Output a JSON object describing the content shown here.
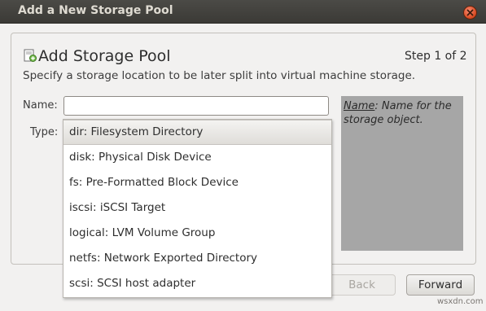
{
  "window": {
    "title": "Add a New Storage Pool"
  },
  "header": {
    "title": "Add Storage Pool",
    "step": "Step 1 of 2",
    "subtitle": "Specify a storage location to be later split into virtual machine storage."
  },
  "form": {
    "name_label": "Name:",
    "name_value": "",
    "type_label": "Type:",
    "type_options": [
      "dir: Filesystem Directory",
      "disk: Physical Disk Device",
      "fs: Pre-Formatted Block Device",
      "iscsi: iSCSI Target",
      "logical: LVM Volume Group",
      "netfs: Network Exported Directory",
      "scsi: SCSI host adapter"
    ],
    "selected_index": 0
  },
  "help": {
    "term": "Name",
    "text": ": Name for the storage object."
  },
  "buttons": {
    "back": "Back",
    "forward": "Forward"
  },
  "watermark": "wsxdn.com",
  "colors": {
    "titlebar": "#3c3b37",
    "help_bg": "#a6a6a6",
    "close": "#df4a16"
  }
}
